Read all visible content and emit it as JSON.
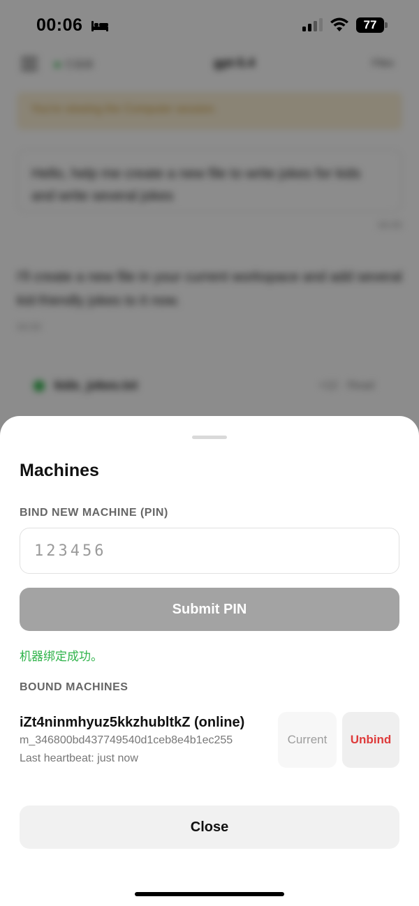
{
  "status_bar": {
    "time": "00:06",
    "battery": "77",
    "icons": [
      "bed-icon",
      "cellular-signal-icon",
      "wifi-icon",
      "battery-icon"
    ]
  },
  "background_app": {
    "status": "已连接",
    "title": "gpt-5.4",
    "files_label": "Files",
    "banner": "You're viewing the Computer session.",
    "user_message": "Hello, help me create a new file to write jokes for kids and write several jokes",
    "message_time": "00:05",
    "assistant_message": "I'll create a new file in your current workspace and add several kid-friendly jokes to it now.",
    "assistant_meta": "00:05",
    "file_name": "kids_jokes.txt",
    "file_actions": "+12 · Read"
  },
  "sheet": {
    "title": "Machines",
    "bind_label": "BIND NEW MACHINE (PIN)",
    "pin_placeholder": "123456",
    "pin_value": "",
    "submit_label": "Submit PIN",
    "success_message": "机器绑定成功。",
    "bound_label": "BOUND MACHINES",
    "machines": [
      {
        "name": "iZt4ninmhyuz5kkzhubltkZ (online)",
        "id": "m_346800bd437749540d1ceb8e4b1ec255",
        "heartbeat": "Last heartbeat: just now",
        "current_label": "Current",
        "unbind_label": "Unbind"
      }
    ],
    "close_label": "Close"
  },
  "colors": {
    "success": "#2fb34a",
    "danger": "#de3b3b",
    "submit_disabled": "#a3a3a3"
  }
}
